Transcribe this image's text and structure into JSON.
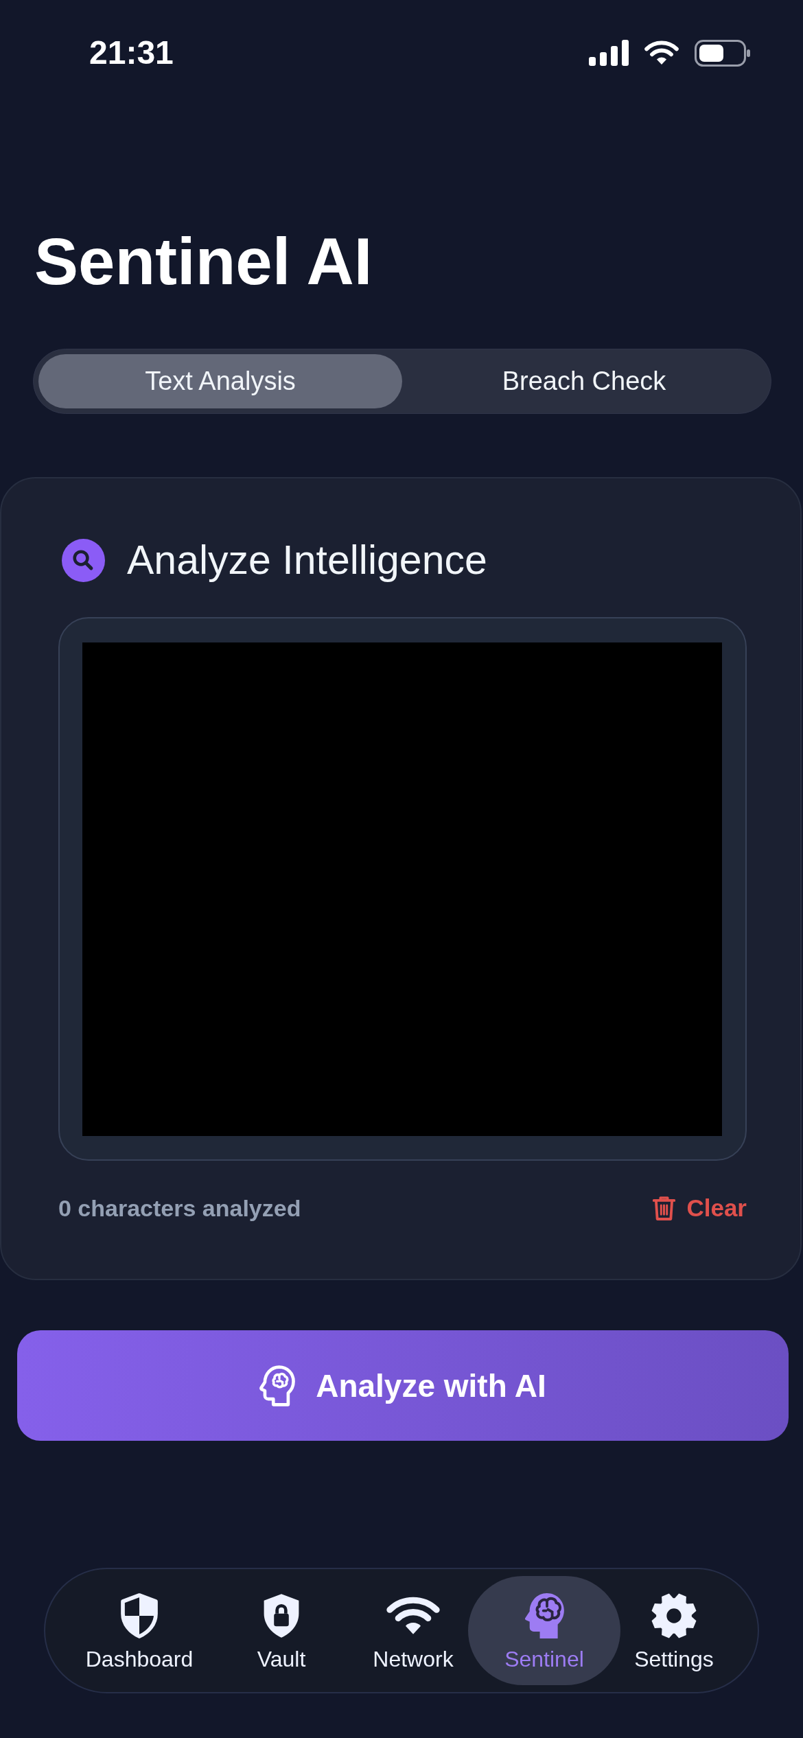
{
  "status_bar": {
    "time": "21:31"
  },
  "title": "Sentinel AI",
  "tabs": [
    {
      "label": "Text Analysis",
      "selected": true
    },
    {
      "label": "Breach Check",
      "selected": false
    }
  ],
  "card": {
    "title": "Analyze Intelligence",
    "character_count": "0 characters analyzed",
    "clear_label": "Clear"
  },
  "analyze_button": {
    "label": "Analyze with AI"
  },
  "tab_bar": [
    {
      "label": "Dashboard",
      "selected": false
    },
    {
      "label": "Vault",
      "selected": false
    },
    {
      "label": "Network",
      "selected": false
    },
    {
      "label": "Sentinel",
      "selected": true
    },
    {
      "label": "Settings",
      "selected": false
    }
  ]
}
